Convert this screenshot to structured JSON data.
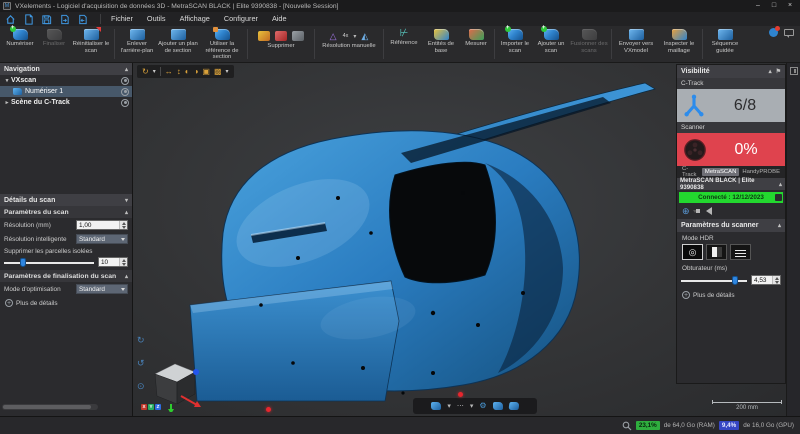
{
  "titlebar": {
    "title": "VXelements - Logiciel d'acquisition de données 3D - MetraSCAN BLACK | Elite 9390838 - [Nouvelle Session]",
    "app_badge": "M"
  },
  "menubar": {
    "items": [
      "Fichier",
      "Outils",
      "Affichage",
      "Configurer",
      "Aide"
    ]
  },
  "toolbar": {
    "buttons": [
      {
        "label": "Numériser",
        "disabled": false
      },
      {
        "label": "Finaliser",
        "disabled": true
      },
      {
        "label": "Réinitialiser le scan",
        "disabled": false
      },
      {
        "label": "Enlever l'arrière-plan",
        "disabled": false
      },
      {
        "label": "Ajouter un plan de section",
        "disabled": false
      },
      {
        "label": "Utiliser la référence de section",
        "disabled": false
      },
      {
        "label": "Référence",
        "disabled": false
      },
      {
        "label": "Entités de base",
        "disabled": false
      },
      {
        "label": "Mesurer",
        "disabled": false
      },
      {
        "label": "Importer le scan",
        "disabled": false
      },
      {
        "label": "Ajouter un scan",
        "disabled": false
      },
      {
        "label": "Fusionner des scans",
        "disabled": true
      },
      {
        "label": "Envoyer vers VXmodel",
        "disabled": false
      },
      {
        "label": "Inspecter le maillage",
        "disabled": false
      },
      {
        "label": "Séquence guidée",
        "disabled": false
      }
    ],
    "group_supprimer": "Supprimer",
    "group_resolution": "Résolution manuelle",
    "resolution_badge": "4x"
  },
  "navigation": {
    "title": "Navigation",
    "items": [
      {
        "label": "VXscan"
      },
      {
        "label": "Numériser 1"
      },
      {
        "label": "Scène du C-Track"
      }
    ]
  },
  "scan_details": {
    "title": "Détails du scan",
    "params_title": "Paramètres du scan",
    "resolution_label": "Résolution (mm)",
    "resolution_value": "1,00",
    "smart_resolution_label": "Résolution intelligente",
    "smart_resolution_value": "Standard",
    "isolated_label": "Supprimer les parcelles isolées",
    "isolated_value": "10",
    "finalize_title": "Paramètres de finalisation du scan",
    "optimization_label": "Mode d'optimisation",
    "optimization_value": "Standard",
    "more_details": "Plus de détails"
  },
  "visibility": {
    "title": "Visibilité",
    "ctrack_label": "C-Track",
    "ctrack_value": "6/8",
    "scanner_label": "Scanner",
    "scanner_value": "0%",
    "tabs": [
      "C-Track",
      "MetraSCAN",
      "HandyPROBE"
    ],
    "active_tab": "MetraSCAN",
    "device_title": "MetraSCAN BLACK | Elite 9390838",
    "connection": "Connecté : 12/12/2023",
    "scanner_params_title": "Paramètres du scanner",
    "hdr_label": "Mode HDR",
    "shutter_label": "Obturateur (ms)",
    "shutter_value": "4,53",
    "more_details": "Plus de détails"
  },
  "viewport": {
    "scale_label": "200 mm"
  },
  "statusbar": {
    "ram_percent": "23,1%",
    "ram_text": "de 64,0 Go (RAM)",
    "gpu_percent": "9,4%",
    "gpu_text": "de 16,0 Go (GPU)"
  },
  "icons": {
    "caret_down": "▾",
    "caret_up": "▴",
    "caret_right": "▸",
    "minimize": "–",
    "maximize": "□",
    "close": "×",
    "more": "⋯",
    "gear": "⚙",
    "plus": "+",
    "pin": "⚑",
    "rotate": "↻",
    "rotate_ccw": "↺",
    "orbit": "⊙",
    "flip_h": "↔",
    "flip_v": "↕",
    "half_left": "◐",
    "half_right": "◑",
    "boxed": "▣",
    "hatch": "▩",
    "triangle": "△",
    "compass": "◭",
    "target": "⊕",
    "camera": "◎"
  },
  "colors": {
    "accent": "#2d8ceb",
    "ctrack_ok": "#a9aeb3",
    "scanner_error": "#df434e",
    "connected": "#23d82f"
  }
}
